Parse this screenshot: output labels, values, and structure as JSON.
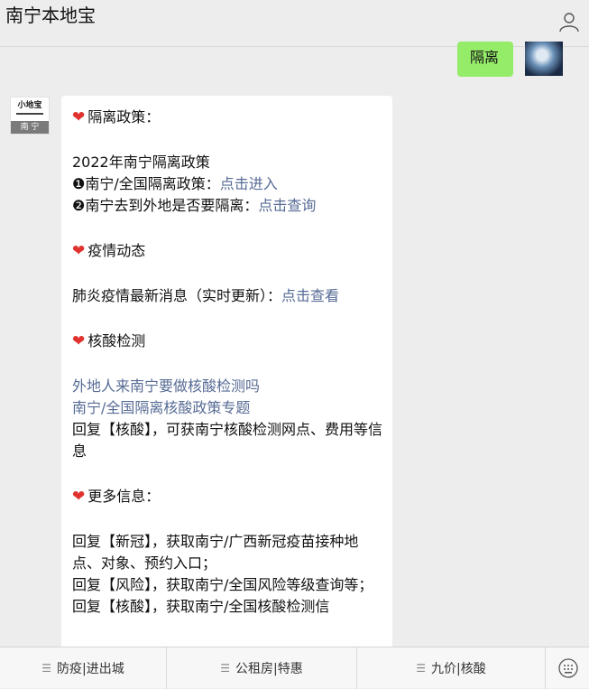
{
  "header": {
    "title": "南宁本地宝",
    "user_icon": "user-icon"
  },
  "outgoing": {
    "text": "隔离"
  },
  "account": {
    "logo_text": "小地宝",
    "city_tag": "南 宁"
  },
  "message": {
    "sec1_title": "隔离政策：",
    "policy_title": "2022年南宁隔离政策",
    "item1_text": "❶南宁/全国隔离政策：",
    "item1_link": "点击进入",
    "item2_text": "❷南宁去到外地是否要隔离：",
    "item2_link": "点击查询",
    "sec2_title": "疫情动态",
    "news_text": "肺炎疫情最新消息（实时更新）：",
    "news_link": "点击查看",
    "sec3_title": "核酸检测",
    "test_link1": "外地人来南宁要做核酸检测吗",
    "test_link2": "南宁/全国隔离核酸政策专题",
    "test_reply": "回复【核酸】，可获南宁核酸检测网点、费用等信息",
    "sec4_title": "更多信息：",
    "more1": "回复【新冠】，获取南宁/广西新冠疫苗接种地点、对象、预约入口；",
    "more2": "回复【风险】，获取南宁/全国风险等级查询等；",
    "more3": "回复【核酸】，获取南宁/全国核酸检测信"
  },
  "menu": {
    "item1": "防疫|进出城",
    "item2": "公租房|特惠",
    "item3": "九价|核酸"
  },
  "colors": {
    "link": "#576b95",
    "bubble_out": "#95ec69",
    "heart": "#e0332e"
  }
}
